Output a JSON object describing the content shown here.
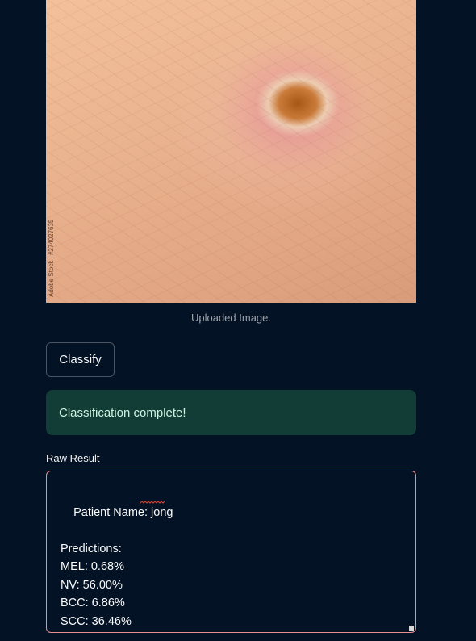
{
  "image": {
    "watermark": "Adobe Stock | #274027635",
    "caption": "Uploaded Image."
  },
  "classify_button": {
    "label": "Classify"
  },
  "alert": {
    "text": "Classification complete!"
  },
  "raw_result": {
    "label": "Raw Result",
    "text": "Patient Name: jong\n\nPredictions:\nMEL: 0.68%\nNV: 56.00%\nBCC: 6.86%\nSCC: 36.46%"
  },
  "colors": {
    "background": "#031225",
    "alert_bg": "#123d36",
    "alert_text": "#cef3e0",
    "textarea_border": "#e88f92"
  }
}
